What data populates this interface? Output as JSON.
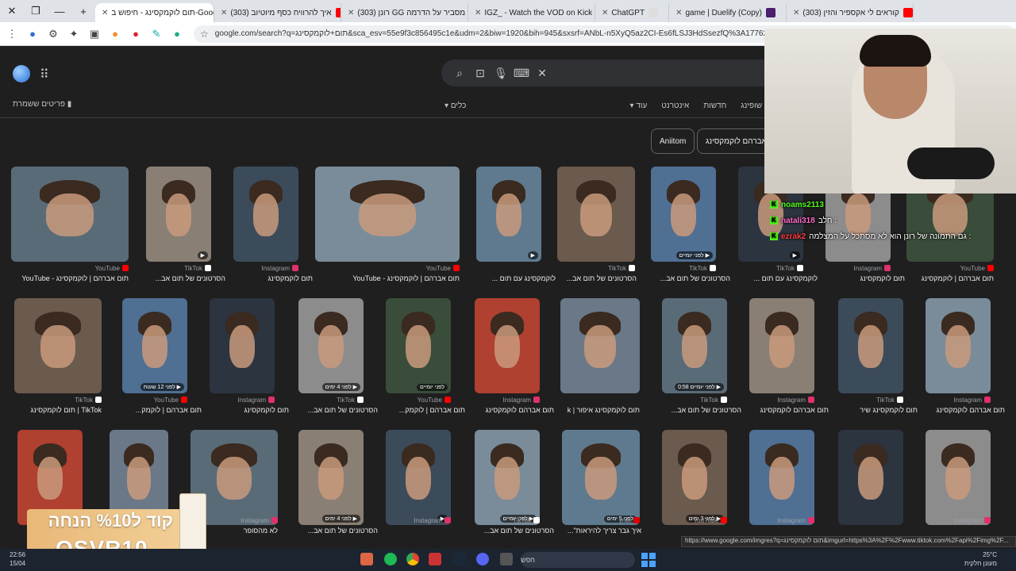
{
  "browser": {
    "tabs": [
      {
        "label": "תום לוקמקסינג - חיפוש ב-Google",
        "active": true,
        "fav": "#4285f4"
      },
      {
        "label": "(303) איך להרוויח כסף מיוטיוב",
        "active": false,
        "fav": "#ff0000"
      },
      {
        "label": "(303) רונן GG מסביר על הדרמה",
        "active": false,
        "fav": "#ff0000"
      },
      {
        "label": "IGZ_ - Watch the VOD on Kick",
        "active": false,
        "fav": "#53fc18"
      },
      {
        "label": "ChatGPT",
        "active": false,
        "fav": "#dddddd"
      },
      {
        "label": "game | Duelify (Copy)",
        "active": false,
        "fav": "#4b1e6e"
      },
      {
        "label": "(303) קוראים לי אקספיר והזין",
        "active": false,
        "fav": "#ff0000"
      }
    ],
    "new_tab": "+",
    "url": "google.com/search?q=תום+לוקמקסינג&sca_esv=55e9f3c856495c1e&udm=2&biw=1920&bih=945&sxsrf=ANbL-n5XyQ5az2CI-Es6fLSJ3HdSsezfQ%3A1776282901349"
  },
  "google": {
    "saved": "פריטים ששמרת",
    "filters": [
      "שופינג",
      "חדשות",
      "אינטרנט",
      "עוד"
    ],
    "tools": "כלים",
    "chips": [
      "אברהם לוקמקסינג",
      "Aniitom"
    ]
  },
  "results": [
    {
      "row": 0,
      "items": [
        {
          "src": "YouTube",
          "cap": "תום אברהם | לוקמקסינג - YouTube",
          "ov": ""
        },
        {
          "src": "TikTok",
          "cap": "הסרטונים של תום אב...",
          "ov": "▶"
        },
        {
          "src": "Instagram",
          "cap": "תום לוקמקסינג",
          "ov": ""
        },
        {
          "src": "YouTube",
          "cap": "תום אברהם | לוקמקסינג - YouTube",
          "ov": ""
        },
        {
          "src": "",
          "cap": "לוקמקסינג עם תום ...",
          "ov": "▶"
        },
        {
          "src": "TikTok",
          "cap": "הסרטונים של תום אב...",
          "ov": ""
        },
        {
          "src": "TikTok",
          "cap": "הסרטונים של תום אב...",
          "ov": "לפני יומיים ▶"
        },
        {
          "src": "TikTok",
          "cap": "לוקמקסינג עם תום ...",
          "ov": "▶"
        },
        {
          "src": "Instagram",
          "cap": "תום לוקמקסינג",
          "ov": ""
        },
        {
          "src": "YouTube",
          "cap": "תום אברהם | לוקמקסינג",
          "ov": ""
        }
      ]
    },
    {
      "row": 1,
      "items": [
        {
          "src": "TikTok",
          "cap": "TikTok | תום לוקמקסינג",
          "ov": ""
        },
        {
          "src": "YouTube",
          "cap": "תום אברהם | לוקמק...",
          "ov": "לפני 12 שעות ▶"
        },
        {
          "src": "Instagram",
          "cap": "תום לוקמקסינג",
          "ov": ""
        },
        {
          "src": "TikTok",
          "cap": "הסרטונים של תום אב...",
          "ov": "לפני 4 ימים ▶"
        },
        {
          "src": "YouTube",
          "cap": "תום אברהם | לוקמק...",
          "ov": "לפני יומיים"
        },
        {
          "src": "Instagram",
          "cap": "תום אברהם לוקמקסינג",
          "ov": ""
        },
        {
          "src": "",
          "cap": "תום לוקמקסינג איפור | k",
          "ov": ""
        },
        {
          "src": "TikTok",
          "cap": "הסרטונים של תום אב...",
          "ov": "לפני יומיים 0:58 ▶"
        },
        {
          "src": "Instagram",
          "cap": "תום אברהם לוקמקסינג",
          "ov": ""
        },
        {
          "src": "TikTok",
          "cap": "תום לוקמקסינג שיר",
          "ov": ""
        },
        {
          "src": "Instagram",
          "cap": "תום אברהם לוקמקסינג",
          "ov": ""
        }
      ]
    },
    {
      "row": 2,
      "items": [
        {
          "src": "",
          "cap": "",
          "ov": ""
        },
        {
          "src": "",
          "cap": "",
          "ov": ""
        },
        {
          "src": "Instagram",
          "cap": "לא מהסופר",
          "ov": ""
        },
        {
          "src": "",
          "cap": "הסרטונים של תום אב...",
          "ov": "לפני 4 ימים ▶"
        },
        {
          "src": "Instagram",
          "cap": "",
          "ov": "▶"
        },
        {
          "src": "TikTok",
          "cap": "הסרטונים של תום אב...",
          "ov": "לפני יומיים ▶"
        },
        {
          "src": "ynet",
          "cap": "איך גבר צריך להיראות\"...",
          "ov": "לפני 5 ימים"
        },
        {
          "src": "YouTube",
          "cap": "",
          "ov": "לפני 3 ימים ▶"
        },
        {
          "src": "Instagram",
          "cap": "",
          "ov": ""
        },
        {
          "src": "",
          "cap": "",
          "ov": ""
        },
        {
          "src": "Instagram",
          "cap": "",
          "ov": ""
        }
      ]
    }
  ],
  "chat": [
    {
      "user": "noams2113",
      "msg": "",
      "color": "#53fc18"
    },
    {
      "user": "natali318",
      "msg": ": חלב",
      "color": "#ff69c8"
    },
    {
      "user": "ezrak2",
      "msg": ": גם התמונה של רונן הוא לא מסתכל על המצלמה",
      "color": "#ff3b3b"
    }
  ],
  "promo": {
    "line1": "קוד ל%10 הנחה",
    "line2": "OSVR10"
  },
  "status_url": "https://www.google.com/imgres?q=תום לוקמקסינג&imgurl=https%3A%2F%2Fwww.tiktok.com%2Fapi%2Fimg%2F...",
  "taskbar": {
    "time": "22:56",
    "date": "15/04",
    "search": "חפש",
    "temp": "25°C",
    "weather": "מעונן חלקית"
  },
  "colors": {
    "accent": "#8ab4f8",
    "page_bg": "#1f1f1f",
    "kick_green": "#53fc18"
  }
}
